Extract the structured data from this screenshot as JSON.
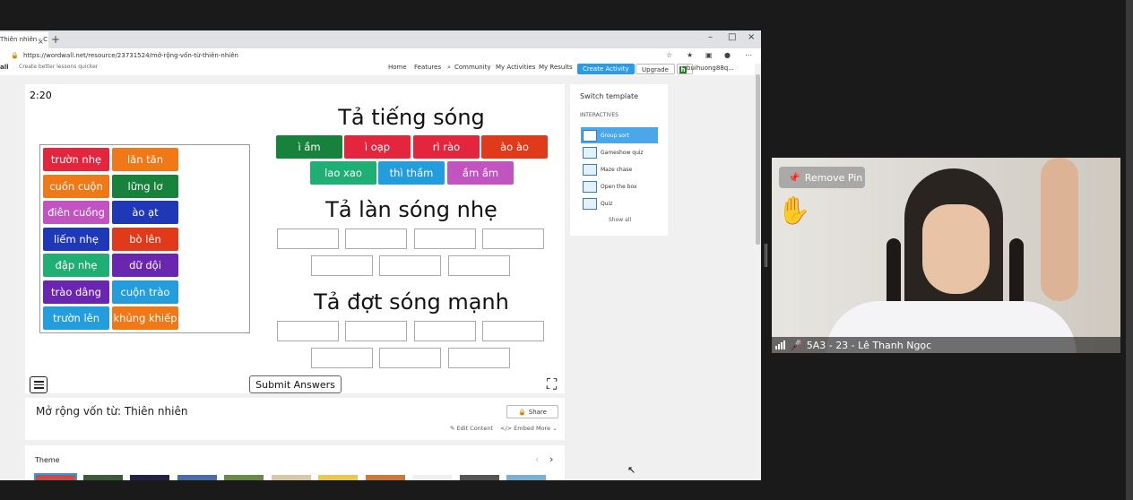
{
  "browser": {
    "tab_title": "Thiên nhiên - C",
    "tab_close": "×",
    "new_tab": "+",
    "win_minimize": "–",
    "win_maximize": "□",
    "win_close": "×",
    "url": "https://wordwall.net/resource/23731524/mở-rộng-vốn-từ-thiên-nhiên"
  },
  "site_nav": {
    "logo_fragment": "all",
    "tagline": "Create better lessons quicker",
    "home": "Home",
    "features": "Features",
    "community": "Community",
    "my_activities": "My Activities",
    "my_results": "My Results",
    "create_activity": "Create Activity",
    "upgrade": "Upgrade",
    "account_initial": "h",
    "account_name": "buihuong88q..."
  },
  "game": {
    "timer": "2:20",
    "pool_tiles": [
      {
        "label": "trườn nhẹ",
        "color": "#e3263e"
      },
      {
        "label": "lăn tăn",
        "color": "#f07816"
      },
      {
        "label": "cuồn cuộn",
        "color": "#f07816"
      },
      {
        "label": "lững lơ",
        "color": "#17823c"
      },
      {
        "label": "điên cuồng",
        "color": "#c154c1"
      },
      {
        "label": "ào ạt",
        "color": "#1f38b8"
      },
      {
        "label": "liếm nhẹ",
        "color": "#1f38b8"
      },
      {
        "label": "bò lên",
        "color": "#e03a1a"
      },
      {
        "label": "đập nhẹ",
        "color": "#1fae74"
      },
      {
        "label": "dữ dội",
        "color": "#6a26b0"
      },
      {
        "label": "trào dâng",
        "color": "#6a26b0"
      },
      {
        "label": "cuộn trào",
        "color": "#239ddc"
      },
      {
        "label": "trườn lên",
        "color": "#239ddc"
      },
      {
        "label": "khủng khiếp",
        "color": "#f07816"
      }
    ],
    "groups": [
      {
        "title": "Tả tiếng sóng",
        "tiles": [
          {
            "label": "ì ầm",
            "color": "#17823c"
          },
          {
            "label": "ì oạp",
            "color": "#e3263e"
          },
          {
            "label": "rì rào",
            "color": "#e3263e"
          },
          {
            "label": "ào ào",
            "color": "#e03a1a"
          },
          {
            "label": "lao xao",
            "color": "#1fae74"
          },
          {
            "label": "thì thầm",
            "color": "#239ddc"
          },
          {
            "label": "ầm ầm",
            "color": "#c154c1"
          }
        ]
      },
      {
        "title": "Tả làn sóng nhẹ",
        "empty_slots": 7
      },
      {
        "title": "Tả đợt sóng mạnh",
        "empty_slots": 7
      }
    ],
    "submit_label": "Submit Answers"
  },
  "info": {
    "title": "Mở rộng vốn từ: Thiên nhiên",
    "share": "Share",
    "edit_content": "Edit Content",
    "embed": "Embed",
    "more": "More"
  },
  "theme": {
    "label": "Theme",
    "thumb_colors": [
      "#c84a4a",
      "#3a5a3a",
      "#222244",
      "#4a6aa8",
      "#6a8a4a",
      "#d8c8a8",
      "#e8c850",
      "#c87a3a",
      "#f0f0f0",
      "#555555",
      "#7ab0d8"
    ]
  },
  "templates": {
    "title": "Switch template",
    "subtitle": "INTERACTIVES",
    "items": [
      "Group sort",
      "Gameshow quiz",
      "Maze chase",
      "Open the box",
      "Quiz"
    ],
    "show_all": "Show all"
  },
  "video": {
    "remove_pin": "Remove Pin",
    "reaction": "✋",
    "participant_name": "5A3 - 23 - Lê Thanh Ngọc"
  }
}
